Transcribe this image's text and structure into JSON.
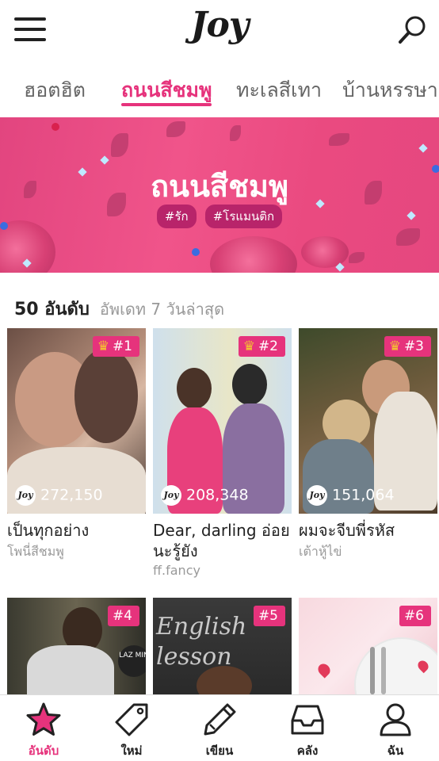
{
  "header": {
    "logo": "Joy"
  },
  "tabs": [
    {
      "label": "ฮอตฮิต"
    },
    {
      "label": "ถนนสีชมพู"
    },
    {
      "label": "ทะเลสีเทา"
    },
    {
      "label": "บ้านหรรษา"
    }
  ],
  "active_tab": "ถนนสีชมพู",
  "banner": {
    "title": "ถนนสีชมพู",
    "tags": [
      "#รัก",
      "#โรแมนติก"
    ]
  },
  "section": {
    "title": "50 อันดับ",
    "subtitle": "อัพเดท 7 วันล่าสุด"
  },
  "rank_icon": "crown-icon",
  "cards": [
    {
      "rank": "#1",
      "views": "272,150",
      "title": "เป็นทุกอย่าง",
      "author": "โพนี่สีชมพู",
      "show_crown": true
    },
    {
      "rank": "#2",
      "views": "208,348",
      "title": "Dear, darling อ่อยนะรู้ยัง",
      "author": "ff.fancy",
      "show_crown": true
    },
    {
      "rank": "#3",
      "views": "151,064",
      "title": "ผมจะจีบพี่รหัส",
      "author": "เต้าหู้ไข่",
      "show_crown": true
    },
    {
      "rank": "#4"
    },
    {
      "rank": "#5"
    },
    {
      "rank": "#6"
    }
  ],
  "cover_text": {
    "card5_board": "English lesson",
    "card4_sign": "LAZ MIN"
  },
  "views_badge": "Joy",
  "bottom_nav": [
    {
      "label": "อันดับ",
      "icon": "star-icon",
      "active": true
    },
    {
      "label": "ใหม่",
      "icon": "tag-icon"
    },
    {
      "label": "เขียน",
      "icon": "pencil-icon"
    },
    {
      "label": "คลัง",
      "icon": "inbox-tray-icon"
    },
    {
      "label": "ฉัน",
      "icon": "user-icon"
    }
  ],
  "colors": {
    "accent": "#e6337c",
    "banner": "#ec4d84",
    "text": "#222222",
    "muted": "#999999",
    "crown": "#f4c430"
  }
}
